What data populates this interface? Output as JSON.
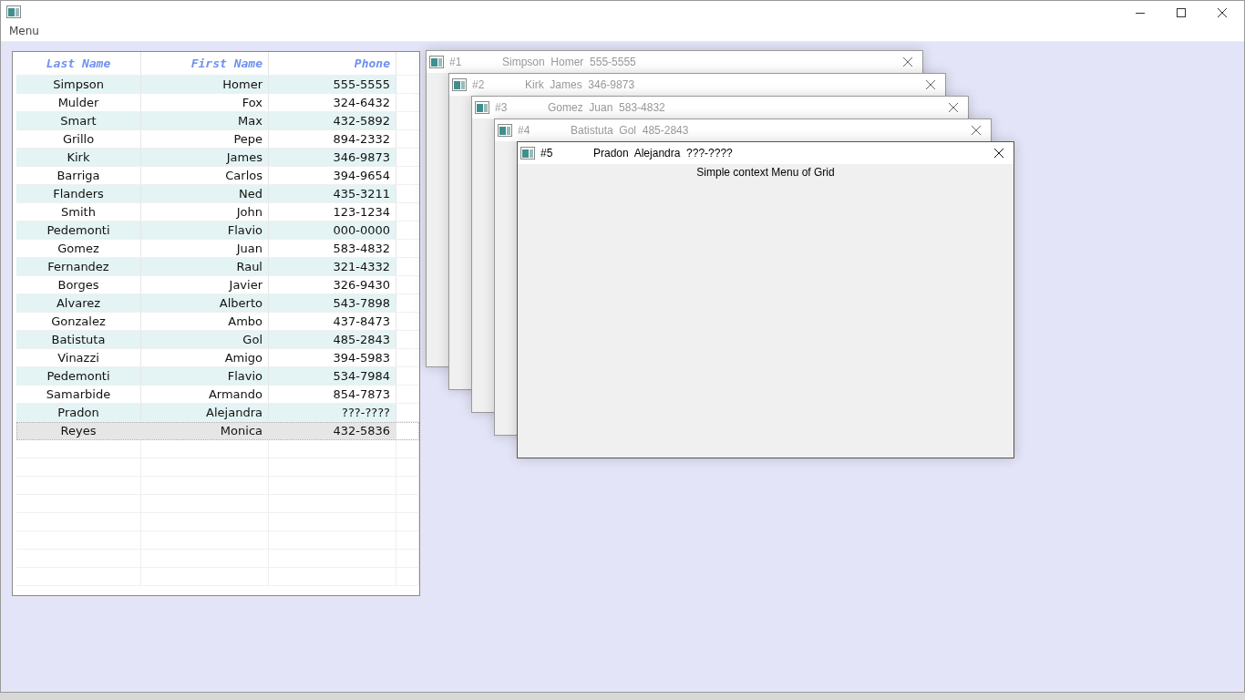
{
  "window": {
    "menu": "Menu"
  },
  "grid": {
    "columns": [
      "Last Name",
      "First Name",
      "Phone"
    ],
    "rows": [
      {
        "cells": [
          "Simpson",
          "Homer",
          "555-5555"
        ],
        "selected": false
      },
      {
        "cells": [
          "Mulder",
          "Fox",
          "324-6432"
        ],
        "selected": false
      },
      {
        "cells": [
          "Smart",
          "Max",
          "432-5892"
        ],
        "selected": false
      },
      {
        "cells": [
          "Grillo",
          "Pepe",
          "894-2332"
        ],
        "selected": false
      },
      {
        "cells": [
          "Kirk",
          "James",
          "346-9873"
        ],
        "selected": false
      },
      {
        "cells": [
          "Barriga",
          "Carlos",
          "394-9654"
        ],
        "selected": false
      },
      {
        "cells": [
          "Flanders",
          "Ned",
          "435-3211"
        ],
        "selected": false
      },
      {
        "cells": [
          "Smith",
          "John",
          "123-1234"
        ],
        "selected": false
      },
      {
        "cells": [
          "Pedemonti",
          "Flavio",
          "000-0000"
        ],
        "selected": false
      },
      {
        "cells": [
          "Gomez",
          "Juan",
          "583-4832"
        ],
        "selected": false
      },
      {
        "cells": [
          "Fernandez",
          "Raul",
          "321-4332"
        ],
        "selected": false
      },
      {
        "cells": [
          "Borges",
          "Javier",
          "326-9430"
        ],
        "selected": false
      },
      {
        "cells": [
          "Alvarez",
          "Alberto",
          "543-7898"
        ],
        "selected": false
      },
      {
        "cells": [
          "Gonzalez",
          "Ambo",
          "437-8473"
        ],
        "selected": false
      },
      {
        "cells": [
          "Batistuta",
          "Gol",
          "485-2843"
        ],
        "selected": false
      },
      {
        "cells": [
          "Vinazzi",
          "Amigo",
          "394-5983"
        ],
        "selected": false
      },
      {
        "cells": [
          "Pedemonti",
          "Flavio",
          "534-7984"
        ],
        "selected": false
      },
      {
        "cells": [
          "Samarbide",
          "Armando",
          "854-7873"
        ],
        "selected": false
      },
      {
        "cells": [
          "Pradon",
          "Alejandra",
          "???-????"
        ],
        "selected": false
      },
      {
        "cells": [
          "Reyes",
          "Monica",
          "432-5836"
        ],
        "selected": true
      }
    ]
  },
  "child_windows": [
    {
      "number": "#1",
      "title": "Simpson  Homer  555-5555",
      "active": false
    },
    {
      "number": "#2",
      "title": "Kirk  James  346-9873",
      "active": false
    },
    {
      "number": "#3",
      "title": "Gomez  Juan  583-4832",
      "active": false
    },
    {
      "number": "#4",
      "title": "Batistuta  Gol  485-2843",
      "active": false
    },
    {
      "number": "#5",
      "title": "Pradon  Alejandra  ???-????",
      "active": true,
      "content": "Simple context Menu of Grid"
    }
  ]
}
